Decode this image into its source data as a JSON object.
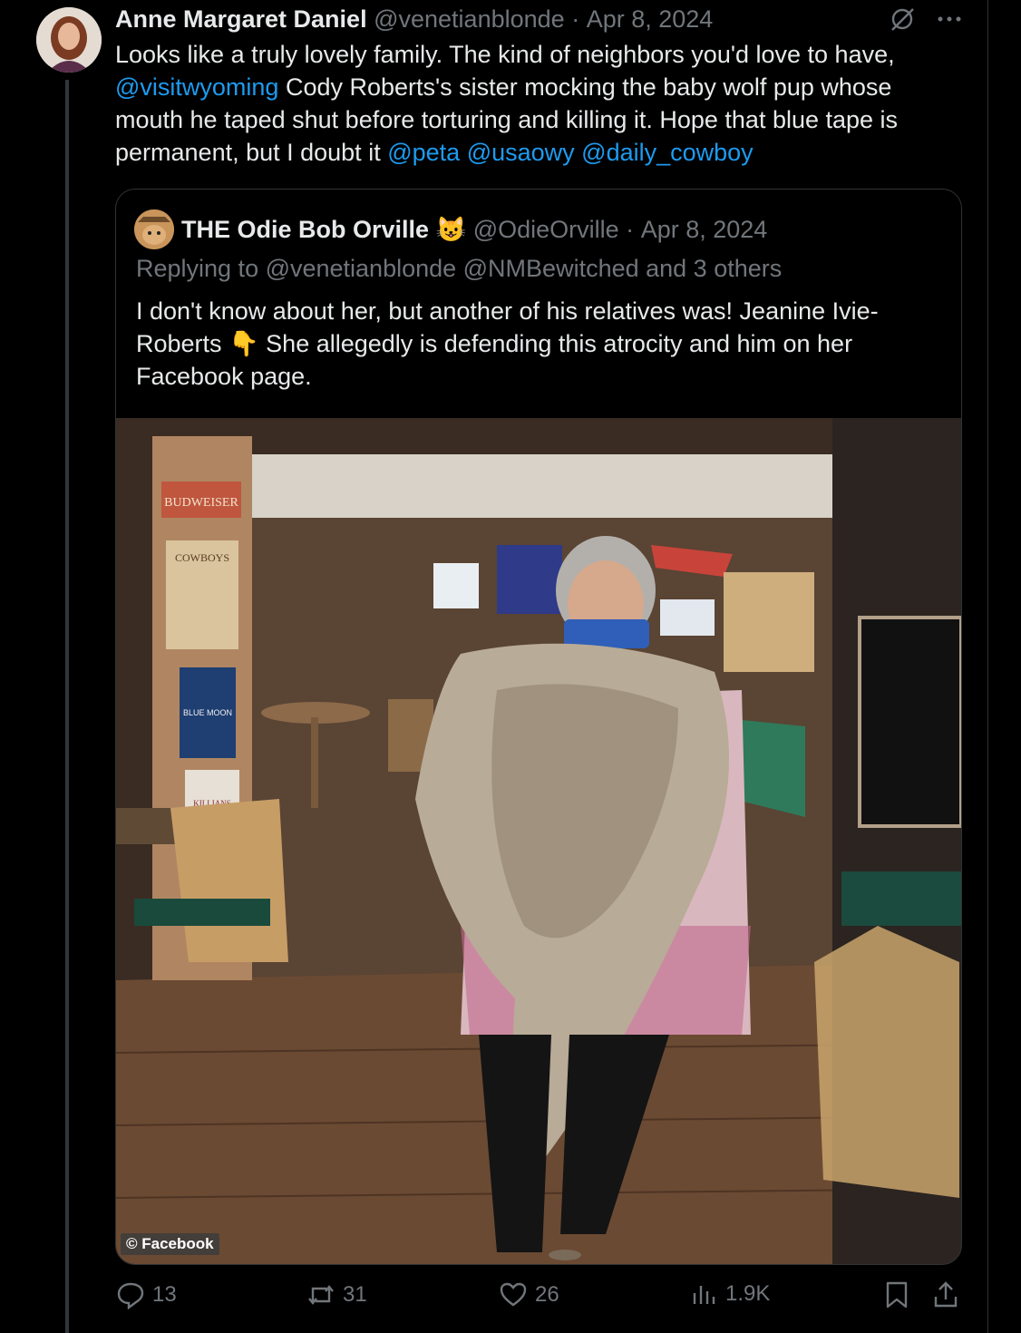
{
  "tweet": {
    "author_name": "Anne Margaret Daniel",
    "handle": "@venetianblonde",
    "separator": "·",
    "date": "Apr 8, 2024",
    "text_parts": {
      "p1": "Looks like a truly lovely family. The kind of neighbors you'd love to have, ",
      "m1": "@visitwyoming",
      "p2": " Cody Roberts's sister mocking the baby wolf pup whose mouth he taped shut before torturing and killing it. Hope that blue tape is permanent, but I doubt it ",
      "m2": "@peta",
      "m3": "@usaowy",
      "m4": "@daily_cowboy"
    }
  },
  "quote": {
    "author_name": "THE Odie Bob Orville",
    "emoji": "😺",
    "handle": "@OdieOrville",
    "separator": "·",
    "date": "Apr 8, 2024",
    "reply_line": "Replying to @venetianblonde @NMBewitched and 3 others",
    "text_p1": "I don't know about her, but another of his relatives was! Jeanine Ivie-Roberts ",
    "pointing_emoji": "👇",
    "text_p2": " She allegedly is defending this atrocity and him on her Facebook page.",
    "photo_credit": "© Facebook",
    "photo_signs": [
      "BUDWEISER",
      "COWBOYS",
      "BLUE MOON",
      "KILLIANS"
    ]
  },
  "actions": {
    "replies": "13",
    "reposts": "31",
    "likes": "26",
    "views": "1.9K"
  },
  "colors": {
    "accent": "#1d9bf0",
    "muted": "#71767b",
    "text": "#e7e9ea",
    "border": "#2f3336"
  },
  "icons": [
    "grok-icon",
    "more-icon",
    "reply-icon",
    "repost-icon",
    "like-icon",
    "views-icon",
    "bookmark-icon",
    "share-icon"
  ]
}
